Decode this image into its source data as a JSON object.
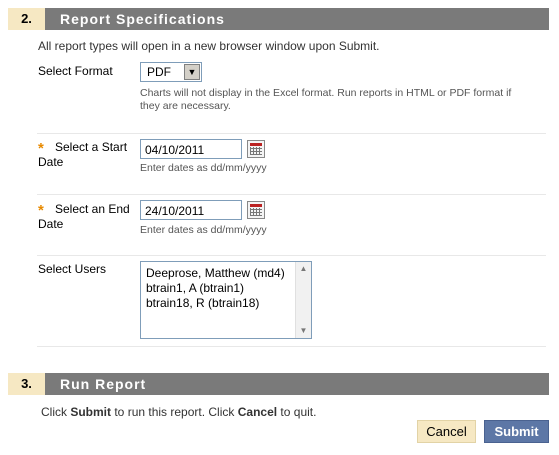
{
  "section2": {
    "number": "2.",
    "title": "Report Specifications",
    "instruction": "All report types will open in a new browser window upon Submit.",
    "format": {
      "label": "Select Format",
      "value": "PDF",
      "hint_line1": "Charts will not display in the Excel format. Run reports in HTML or PDF format if",
      "hint_line2": "they are necessary."
    },
    "start_date": {
      "required_mark": "*",
      "label_line1": "Select a Start",
      "label_line2": "Date",
      "value": "04/10/2011",
      "hint": "Enter dates as dd/mm/yyyy"
    },
    "end_date": {
      "required_mark": "*",
      "label_line1": "Select an End",
      "label_line2": "Date",
      "value": "24/10/2011",
      "hint": "Enter dates as dd/mm/yyyy"
    },
    "users": {
      "label": "Select Users",
      "options": [
        "Deeprose, Matthew (md4)",
        "btrain1, A (btrain1)",
        "btrain18, R (btrain18)"
      ]
    }
  },
  "section3": {
    "number": "3.",
    "title": "Run Report",
    "instruction_parts": [
      "Click ",
      "Submit",
      " to run this report. Click ",
      "Cancel",
      " to quit."
    ],
    "cancel_label": "Cancel",
    "submit_label": "Submit"
  },
  "colors": {
    "bar": "#7a7a7a",
    "step_badge": "#f6e8c3",
    "required_star": "#e88a00",
    "submit_button": "#5d77a6",
    "cancel_button": "#f6e8c3"
  },
  "icons": {
    "calendar": "calendar-icon",
    "dropdown": "chevron-down-icon",
    "scroll_up": "scroll-up-icon",
    "scroll_down": "scroll-down-icon"
  }
}
